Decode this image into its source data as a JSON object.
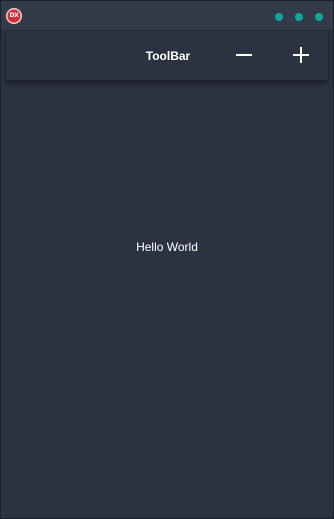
{
  "window": {
    "app_icon": "dx-logo-icon",
    "app_icon_text": "DX",
    "controls": [
      "window-dot",
      "window-dot",
      "window-dot"
    ]
  },
  "toolbar": {
    "title": "ToolBar",
    "minus_icon": "minus-icon",
    "plus_icon": "plus-icon"
  },
  "content": {
    "text": "Hello World"
  },
  "colors": {
    "background": "#2c3340",
    "titlebar": "#343b48",
    "accent": "#0fa89a",
    "icon_red": "#d0303a",
    "text": "#ffffff"
  }
}
